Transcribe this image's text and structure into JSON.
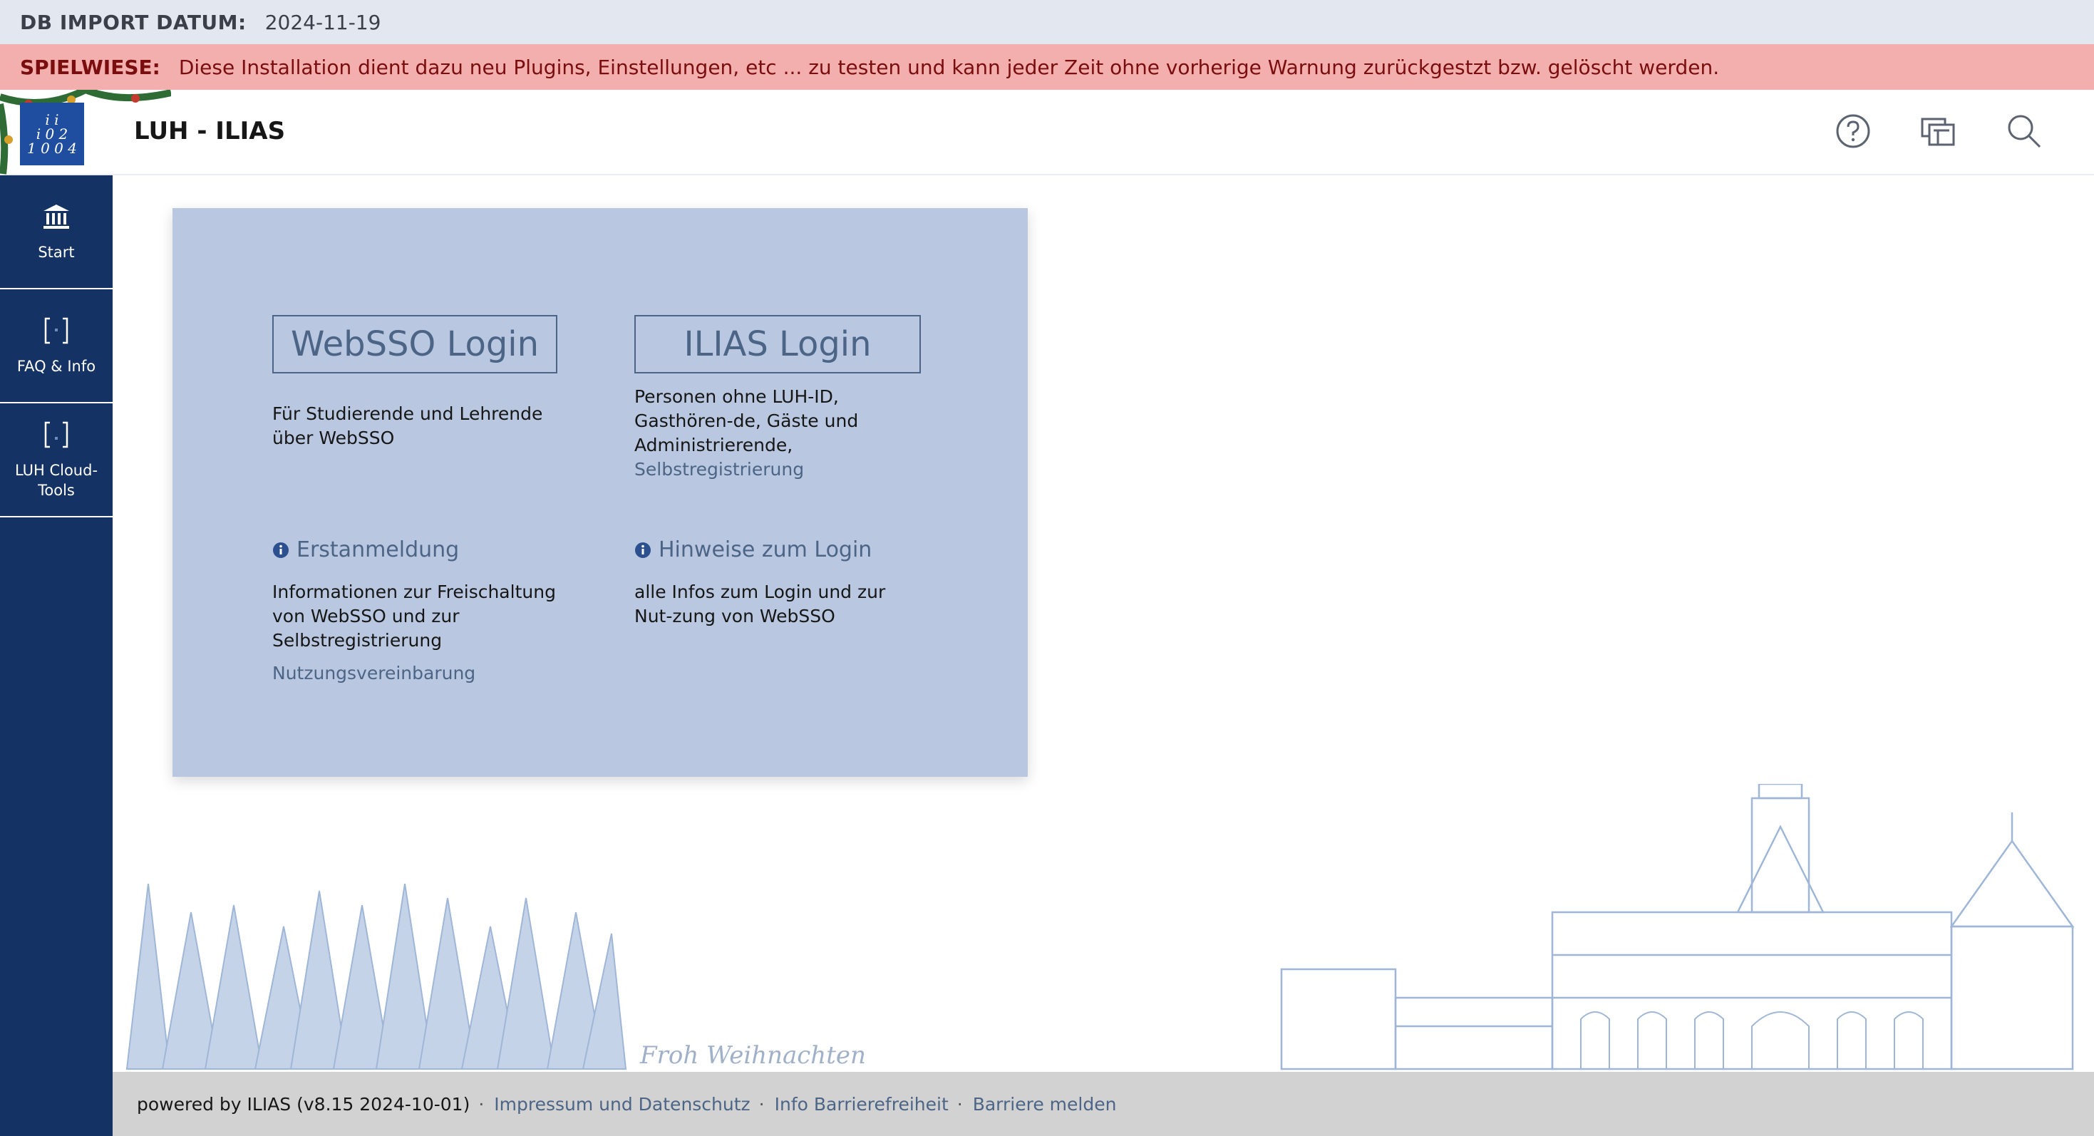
{
  "topbar": {
    "label": "DB IMPORT DATUM:",
    "value": "2024-11-19"
  },
  "warning": {
    "label": "SPIELWIESE:",
    "text": "Diese Installation dient dazu neu Plugins, Einstellungen, etc ... zu testen und kann jeder Zeit ohne vorherige Warnung zurückgestzt bzw. gelöscht werden."
  },
  "header": {
    "title": "LUH - ILIAS",
    "logo_lines": [
      "i i",
      "i 0 2",
      "1 0 0 4"
    ],
    "icons": [
      "help-icon",
      "notification-center-icon",
      "search-icon"
    ]
  },
  "sidebar": {
    "items": [
      {
        "label": "Start",
        "icon": "bank-icon"
      },
      {
        "label": "FAQ & Info",
        "icon": "bracket-icon"
      },
      {
        "label": "LUH Cloud-Tools",
        "icon": "bracket-icon"
      }
    ]
  },
  "login": {
    "websso_button": "WebSSO Login",
    "ilias_button": "ILIAS Login",
    "websso_desc": "Für Studierende und Lehrende über WebSSO",
    "ilias_desc": "Personen ohne LUH-ID, Gasthören-de, Gäste und Administrierende,",
    "ilias_link": "Selbstregistrierung",
    "first_login_title": "Erstanmeldung",
    "first_login_desc": "Informationen zur Freischaltung von WebSSO und zur Selbstregistrierung",
    "hints_title": "Hinweise zum Login",
    "hints_desc": "alle Infos zum Login und zur Nut-zung von WebSSO",
    "terms_link": "Nutzungsvereinbarung"
  },
  "decoration": {
    "greeting": "Froh Weihnachten"
  },
  "footer": {
    "powered": "powered by ILIAS (v8.15 2024-10-01)",
    "links": [
      "Impressum und Datenschutz",
      "Info Barrierefreiheit",
      "Barriere melden"
    ]
  },
  "colors": {
    "sidebar": "#143263",
    "panel": "#b9c8e0",
    "accent": "#4c6586",
    "warning_bg": "#f3aeae",
    "topbar_bg": "#e2e7f0",
    "footer_bg": "#d2d2d2"
  }
}
